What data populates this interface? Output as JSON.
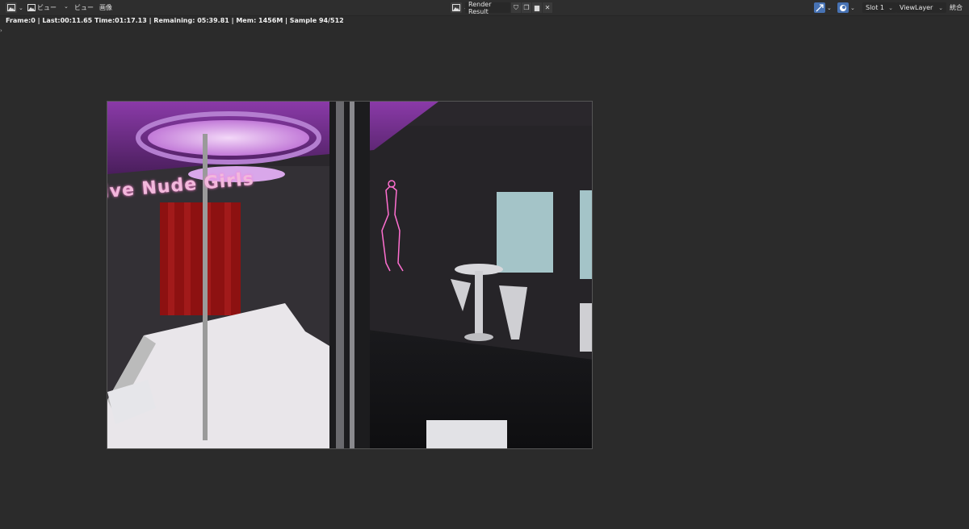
{
  "header": {
    "view_menu_1": "ビュー",
    "view_menu_2": "ビュー",
    "image_menu": "画像",
    "image_name": "Render Result",
    "slot": "Slot 1",
    "view_layer": "ViewLayer",
    "composite": "統合"
  },
  "status": {
    "text": "Frame:0 | Last:00:11.65 Time:01:17.13 | Remaining: 05:39.81 | Mem: 1456M | Sample 94/512"
  },
  "render": {
    "sign_text": "ive Nude Girls"
  },
  "colors": {
    "background": "#2b2b2b",
    "header": "#2e2e2e",
    "accent_blue": "#4772b3",
    "neon_pink": "#ff6fd0"
  }
}
